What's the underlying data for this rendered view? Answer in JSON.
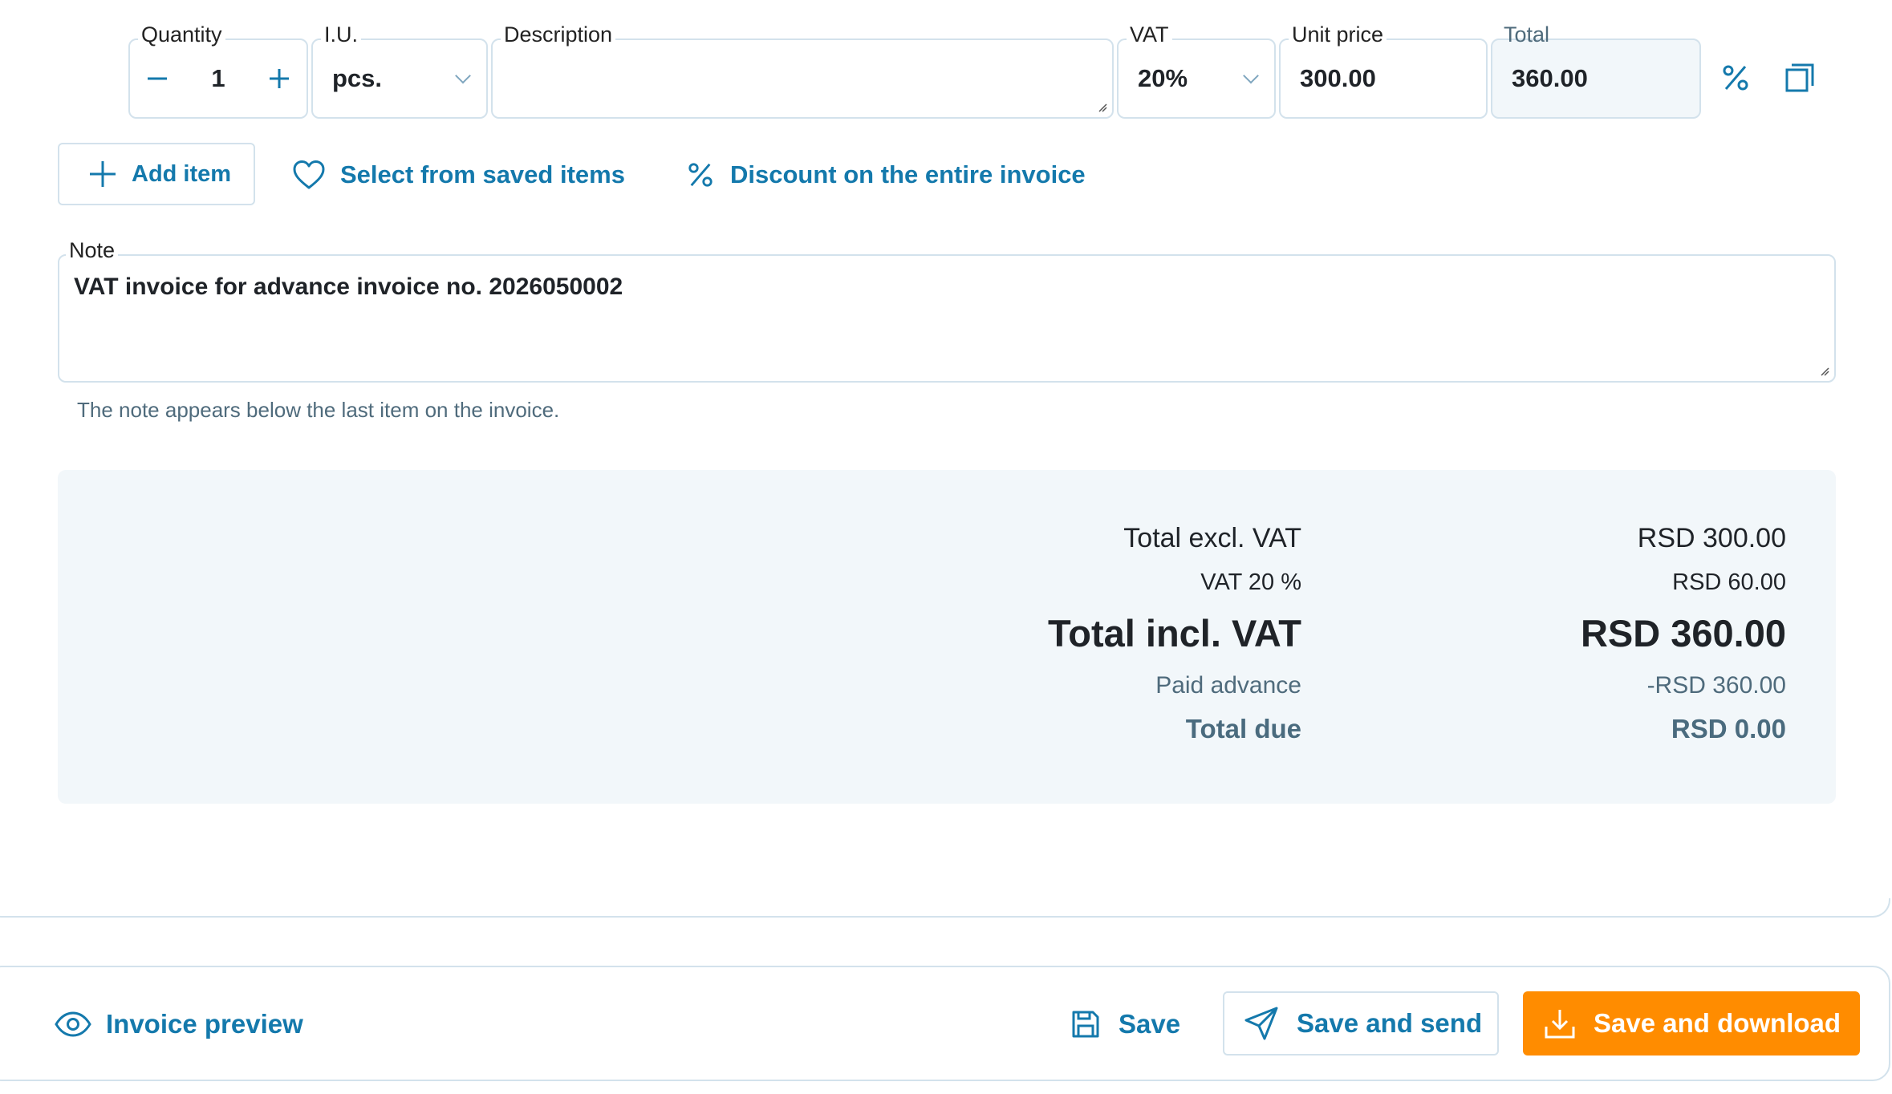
{
  "item_row": {
    "quantity_label": "Quantity",
    "quantity_value": "1",
    "unit_label": "I.U.",
    "unit_value": "pcs.",
    "description_label": "Description",
    "description_value": "",
    "vat_label": "VAT",
    "vat_value": "20%",
    "unit_price_label": "Unit price",
    "unit_price_value": "300.00",
    "total_label": "Total",
    "total_value": "360.00"
  },
  "actions": {
    "add_item": "Add item",
    "select_saved": "Select from saved items",
    "discount_invoice": "Discount on the entire invoice"
  },
  "note": {
    "label": "Note",
    "value": "VAT invoice for advance invoice no. 2026050002",
    "hint": "The note appears below the last item on the invoice."
  },
  "summary": {
    "total_excl_label": "Total excl. VAT",
    "total_excl_value": "RSD 300.00",
    "vat_label": "VAT 20 %",
    "vat_value": "RSD 60.00",
    "total_incl_label": "Total incl. VAT",
    "total_incl_value": "RSD 360.00",
    "paid_advance_label": "Paid advance",
    "paid_advance_value": "-RSD 360.00",
    "total_due_label": "Total due",
    "total_due_value": "RSD 0.00"
  },
  "footer": {
    "preview": "Invoice preview",
    "save": "Save",
    "save_send": "Save and send",
    "save_download": "Save and download"
  },
  "colors": {
    "accent": "#1479ac",
    "primary_button": "#ff8c00",
    "border": "#d3e2ec",
    "summary_bg": "#f2f7fa",
    "muted_text": "#4f6b7c"
  }
}
